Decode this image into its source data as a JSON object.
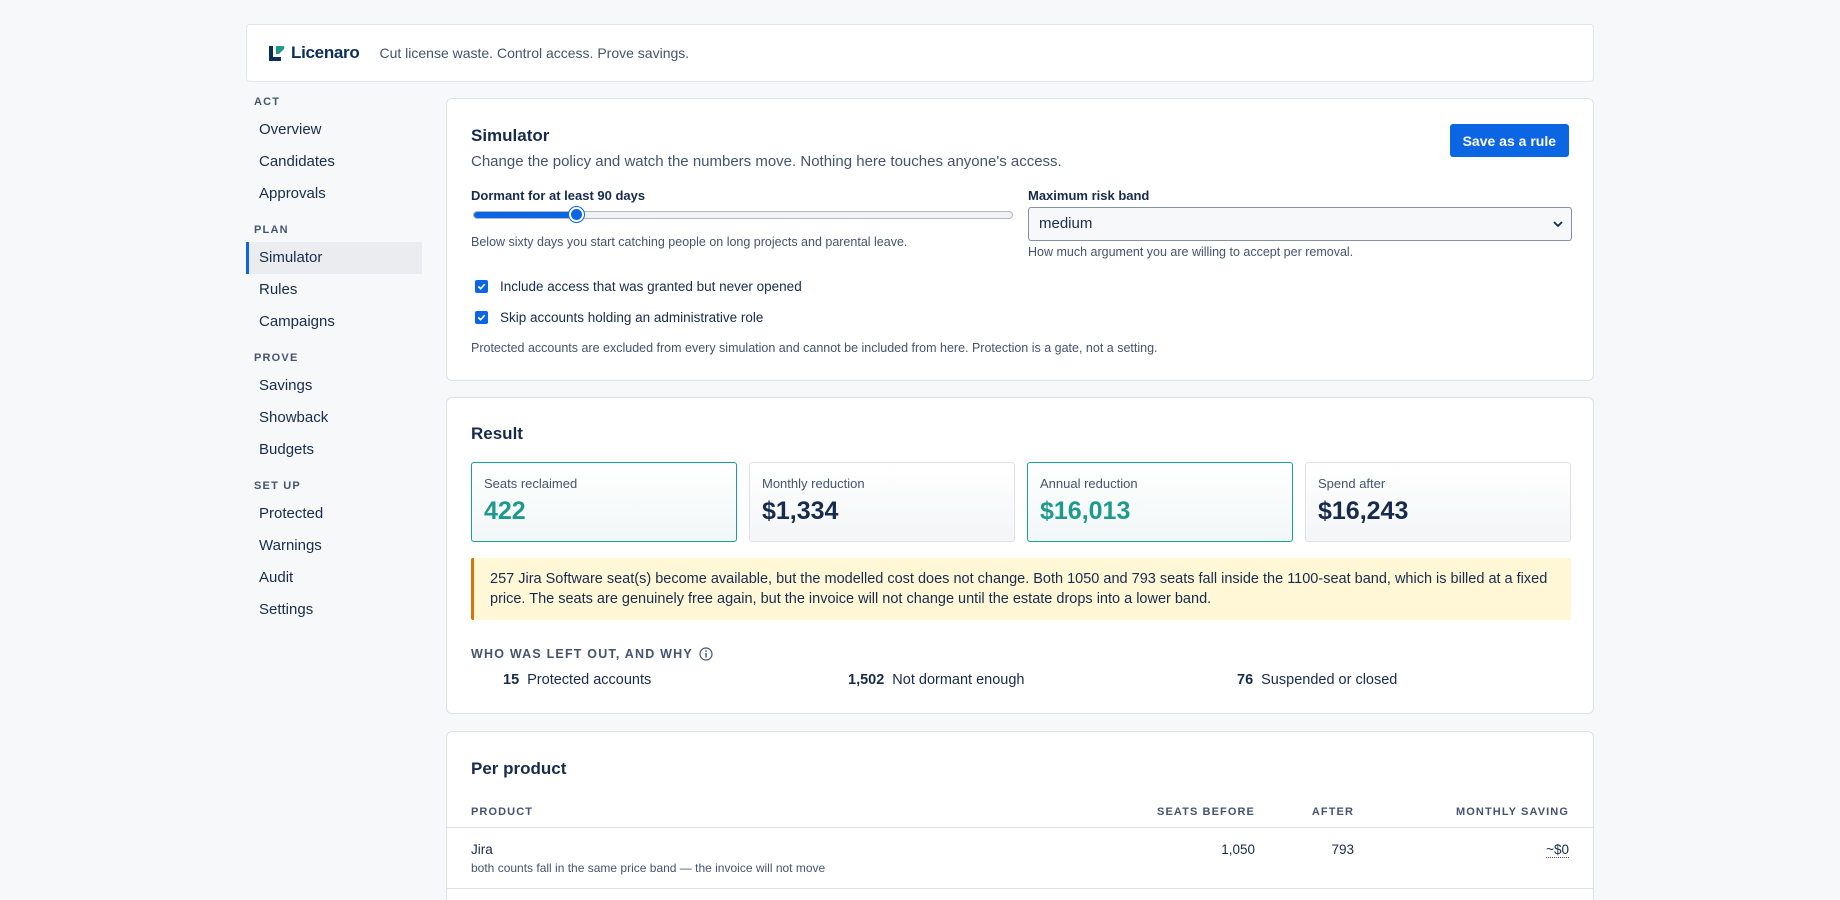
{
  "brand": {
    "name": "Licenaro",
    "tagline": "Cut license waste. Control access. Prove savings."
  },
  "colors": {
    "accent": "#0c66e4",
    "teal": "#1d9a8c",
    "warning_bg": "#fff7d6",
    "warning_border": "#d2770e"
  },
  "sidebar": {
    "sections": [
      {
        "label": "ACT",
        "items": [
          "Overview",
          "Candidates",
          "Approvals"
        ]
      },
      {
        "label": "PLAN",
        "items": [
          "Simulator",
          "Rules",
          "Campaigns"
        ]
      },
      {
        "label": "PROVE",
        "items": [
          "Savings",
          "Showback",
          "Budgets"
        ]
      },
      {
        "label": "SET UP",
        "items": [
          "Protected",
          "Warnings",
          "Audit",
          "Settings"
        ]
      }
    ],
    "active": "Simulator"
  },
  "simulator": {
    "title": "Simulator",
    "description": "Change the policy and watch the numbers move. Nothing here touches anyone's access.",
    "save_button": "Save as a rule",
    "dormant_label": "Dormant for at least 90 days",
    "dormant_value": 90,
    "dormant_fraction": 0.19,
    "dormant_hint": "Below sixty days you start catching people on long projects and parental leave.",
    "risk_label": "Maximum risk band",
    "risk_value": "medium",
    "risk_hint": "How much argument you are willing to accept per removal.",
    "check_never_opened": "Include access that was granted but never opened",
    "check_skip_admin": "Skip accounts holding an administrative role",
    "protected_note": "Protected accounts are excluded from every simulation and cannot be included from here. Protection is a gate, not a setting."
  },
  "result": {
    "title": "Result",
    "stats": [
      {
        "label": "Seats reclaimed",
        "value": "422"
      },
      {
        "label": "Monthly reduction",
        "value": "$1,334"
      },
      {
        "label": "Annual reduction",
        "value": "$16,013"
      },
      {
        "label": "Spend after",
        "value": "$16,243"
      }
    ],
    "warning": "257 Jira Software seat(s) become available, but the modelled cost does not change. Both 1050 and 793 seats fall inside the 1100-seat band, which is billed at a fixed price. The seats are genuinely free again, but the invoice will not change until the estate drops into a lower band.",
    "left_out_title": "WHO WAS LEFT OUT, AND WHY",
    "left_out": [
      {
        "count": "15",
        "label": "Protected accounts"
      },
      {
        "count": "1,502",
        "label": "Not dormant enough"
      },
      {
        "count": "76",
        "label": "Suspended or closed"
      }
    ]
  },
  "per_product": {
    "title": "Per product",
    "columns": [
      "PRODUCT",
      "SEATS BEFORE",
      "AFTER",
      "MONTHLY SAVING"
    ],
    "rows": [
      {
        "product": "Jira",
        "note": "both counts fall in the same price band — the invoice will not move",
        "before": "1,050",
        "after": "793",
        "saving": "~$0"
      }
    ]
  }
}
